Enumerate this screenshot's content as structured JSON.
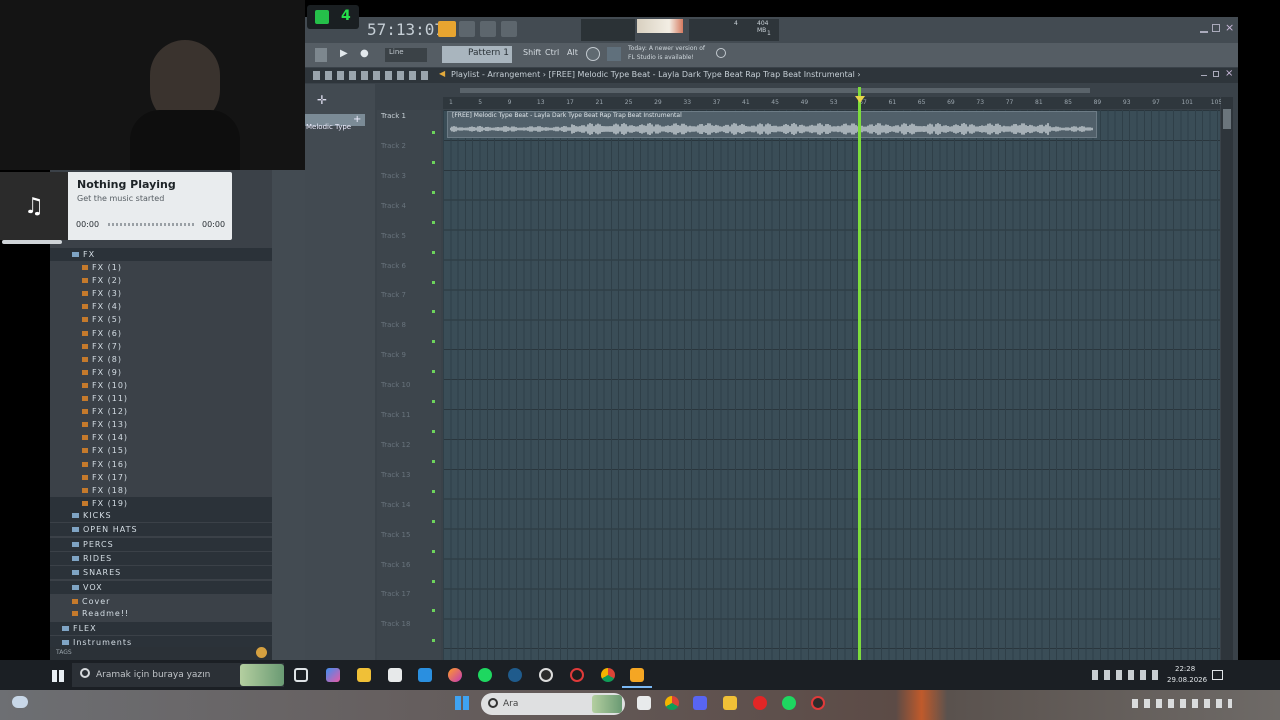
{
  "fl_studio": {
    "time_display": "57:13:07",
    "pattern_label": "Pattern 1",
    "snap_label": "Line",
    "news_line1": "Today: A newer version of",
    "news_line2": "FL Studio is available!",
    "memory": "404 MB",
    "cpu_count": "4",
    "voices": "1",
    "toolbar_buttons": [
      "Shift",
      "Ctrl",
      "Alt"
    ],
    "playlist_title": "Playlist - Arrangement › [FREE] Melodic Type Beat - Layla  Dark Type Beat  Rap Trap Beat Instrumental ›",
    "channel_preset": "Melodic Type",
    "clip_label": "[FREE] Melodic Type Beat - Layla  Dark Type Beat  Rap Trap Beat Instrumental",
    "ruler_ticks": [
      "1",
      "5",
      "9",
      "13",
      "17",
      "21",
      "25",
      "29",
      "33",
      "37",
      "41",
      "45",
      "49",
      "53",
      "57",
      "61",
      "65",
      "69",
      "73",
      "77",
      "81",
      "85",
      "89",
      "93",
      "97",
      "101",
      "105"
    ],
    "tracks": [
      "Track 1",
      "Track 2",
      "Track 3",
      "Track 4",
      "Track 5",
      "Track 6",
      "Track 7",
      "Track 8",
      "Track 9",
      "Track 10",
      "Track 11",
      "Track 12",
      "Track 13",
      "Track 14",
      "Track 15",
      "Track 16",
      "Track 17",
      "Track 18"
    ],
    "logo_badge": "4"
  },
  "browser": {
    "fx_folder": "FX",
    "fx_items": [
      "FX (1)",
      "FX (2)",
      "FX (3)",
      "FX (4)",
      "FX (5)",
      "FX (6)",
      "FX (7)",
      "FX (8)",
      "FX (9)",
      "FX (10)",
      "FX (11)",
      "FX (12)",
      "FX (13)",
      "FX (14)",
      "FX (15)",
      "FX (16)",
      "FX (17)",
      "FX (18)",
      "FX (19)"
    ],
    "folders": [
      "KICKS",
      "OPEN HATS",
      "PERCS",
      "RIDES",
      "SNARES",
      "VOX"
    ],
    "files": [
      "Cover",
      "Readme!!"
    ],
    "bottom_folders": [
      "FLEX",
      "Instruments"
    ],
    "tags_label": "TAGS"
  },
  "media_widget": {
    "title": "Nothing Playing",
    "subtitle": "Get the music started",
    "time_start": "00:00",
    "time_end": "00:00"
  },
  "taskbar": {
    "search_placeholder": "Aramak için buraya yazın",
    "clock_time": "22:28",
    "clock_date": "29.08.2026"
  },
  "taskbar2": {
    "search_placeholder": "Ara"
  }
}
